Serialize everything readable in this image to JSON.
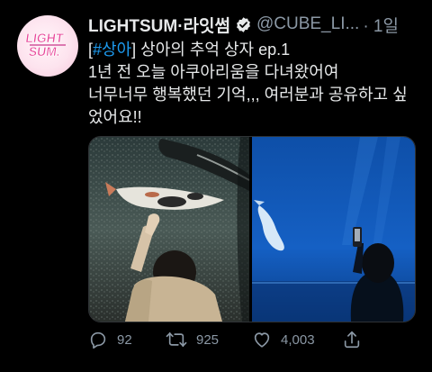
{
  "tweet": {
    "author_name": "LIGHTSUM·라잇썸",
    "handle": "@CUBE_LI...",
    "time": "· 1일",
    "hashtag": "#상아",
    "title_rest": "] 상아의 추억 상자 ep.1",
    "bracket_open": "[",
    "body_lines": [
      "1년 전 오늘 아쿠아리움을 다녀왔어여",
      "너무너무 행복했던 기억,,, 여러분과 공유하고 싶",
      "었어요!!"
    ],
    "avatar_logo_text": "LIGHT SUM"
  },
  "actions": {
    "reply_count": "92",
    "retweet_count": "925",
    "like_count": "4,003"
  },
  "colors": {
    "background": "#000000",
    "text": "#e7e9ea",
    "muted": "#8b98a5",
    "link": "#1d9bf0",
    "verified": "#e7e9ea"
  },
  "icons": [
    "verified-badge-icon",
    "reply-icon",
    "retweet-icon",
    "like-icon",
    "share-icon"
  ]
}
